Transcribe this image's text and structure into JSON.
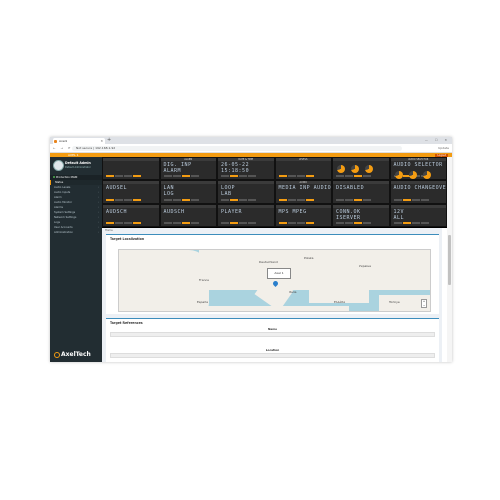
{
  "browser": {
    "tab_title": "Axel1",
    "new_tab": "+",
    "window_controls": "— ☐ ✕",
    "nav": "← → ⟳",
    "address": "Not secure  |  192.168.1.92",
    "account": "Update"
  },
  "topbar": {
    "brand": "AXEL 1",
    "logout": "Logout"
  },
  "sidebar": {
    "user_name": "Default Admin",
    "user_role": "Default Administrator",
    "section": "Production MAIN",
    "items": [
      {
        "label": "Status",
        "active": true
      },
      {
        "label": "Audio Levels",
        "active": false
      },
      {
        "label": "Audio Inputs",
        "active": false
      },
      {
        "label": "Alarm",
        "active": false
      },
      {
        "label": "Audio Monitor",
        "active": false
      },
      {
        "label": "Alarms",
        "active": false
      },
      {
        "label": "System Settings",
        "active": false
      },
      {
        "label": "Network Settings",
        "active": false
      },
      {
        "label": "Logs",
        "active": false
      },
      {
        "label": "User Accounts",
        "active": false
      },
      {
        "label": "Administration",
        "active": false
      }
    ],
    "logo_text": "AxelTech"
  },
  "panel": {
    "cells": [
      {
        "hdr": "",
        "l1": "",
        "l2": ""
      },
      {
        "hdr": "ALARM",
        "l1": "DIG. INP",
        "l2": "ALARM"
      },
      {
        "hdr": "DATE & TIME",
        "l1": "26-05-22",
        "l2": "15:18:50"
      },
      {
        "hdr": "LEVELS",
        "l1": "",
        "l2": ""
      },
      {
        "hdr": "",
        "l1": "",
        "l2": ""
      },
      {
        "hdr": "AUDIO SELECTOR",
        "l1": "AUDIO SELECTOR OUT",
        "l2": ""
      },
      {
        "hdr": "",
        "l1": "AUDSEL",
        "l2": ""
      },
      {
        "hdr": "",
        "l1": "LAN",
        "l2": "LOG"
      },
      {
        "hdr": "",
        "l1": "LOOP",
        "l2": "LAB"
      },
      {
        "hdr": "AUDIO",
        "l1": "MEDIA INP AUDIO",
        "l2": ""
      },
      {
        "hdr": "",
        "l1": "DISABLED",
        "l2": ""
      },
      {
        "hdr": "",
        "l1": "AUDIO CHANGEOVER",
        "l2": ""
      },
      {
        "hdr": "",
        "l1": "AUDSCH",
        "l2": ""
      },
      {
        "hdr": "",
        "l1": "AUDSCH",
        "l2": ""
      },
      {
        "hdr": "",
        "l1": "PLAYER",
        "l2": ""
      },
      {
        "hdr": "",
        "l1": "MPS MPEG",
        "l2": ""
      },
      {
        "hdr": "",
        "l1": "CONN.OK",
        "l2": "ISERVER"
      },
      {
        "hdr": "",
        "l1": "12V",
        "l2": "ALL"
      }
    ]
  },
  "content": {
    "breadcrumb": "Home",
    "location_title": "Target Localization",
    "map": {
      "popup": "Axel 1",
      "zoom": "+ −",
      "labels": [
        "France",
        "España",
        "Italia",
        "Deutschland",
        "Polska",
        "Україна",
        "Türkiye",
        "Ελλάδα"
      ]
    },
    "references_title": "Target References",
    "name_label": "Name",
    "location_label": "Location"
  },
  "colors": {
    "accent": "#f39c12",
    "sidebar": "#222d32",
    "panel": "#202020",
    "link": "#3c8dbc"
  }
}
